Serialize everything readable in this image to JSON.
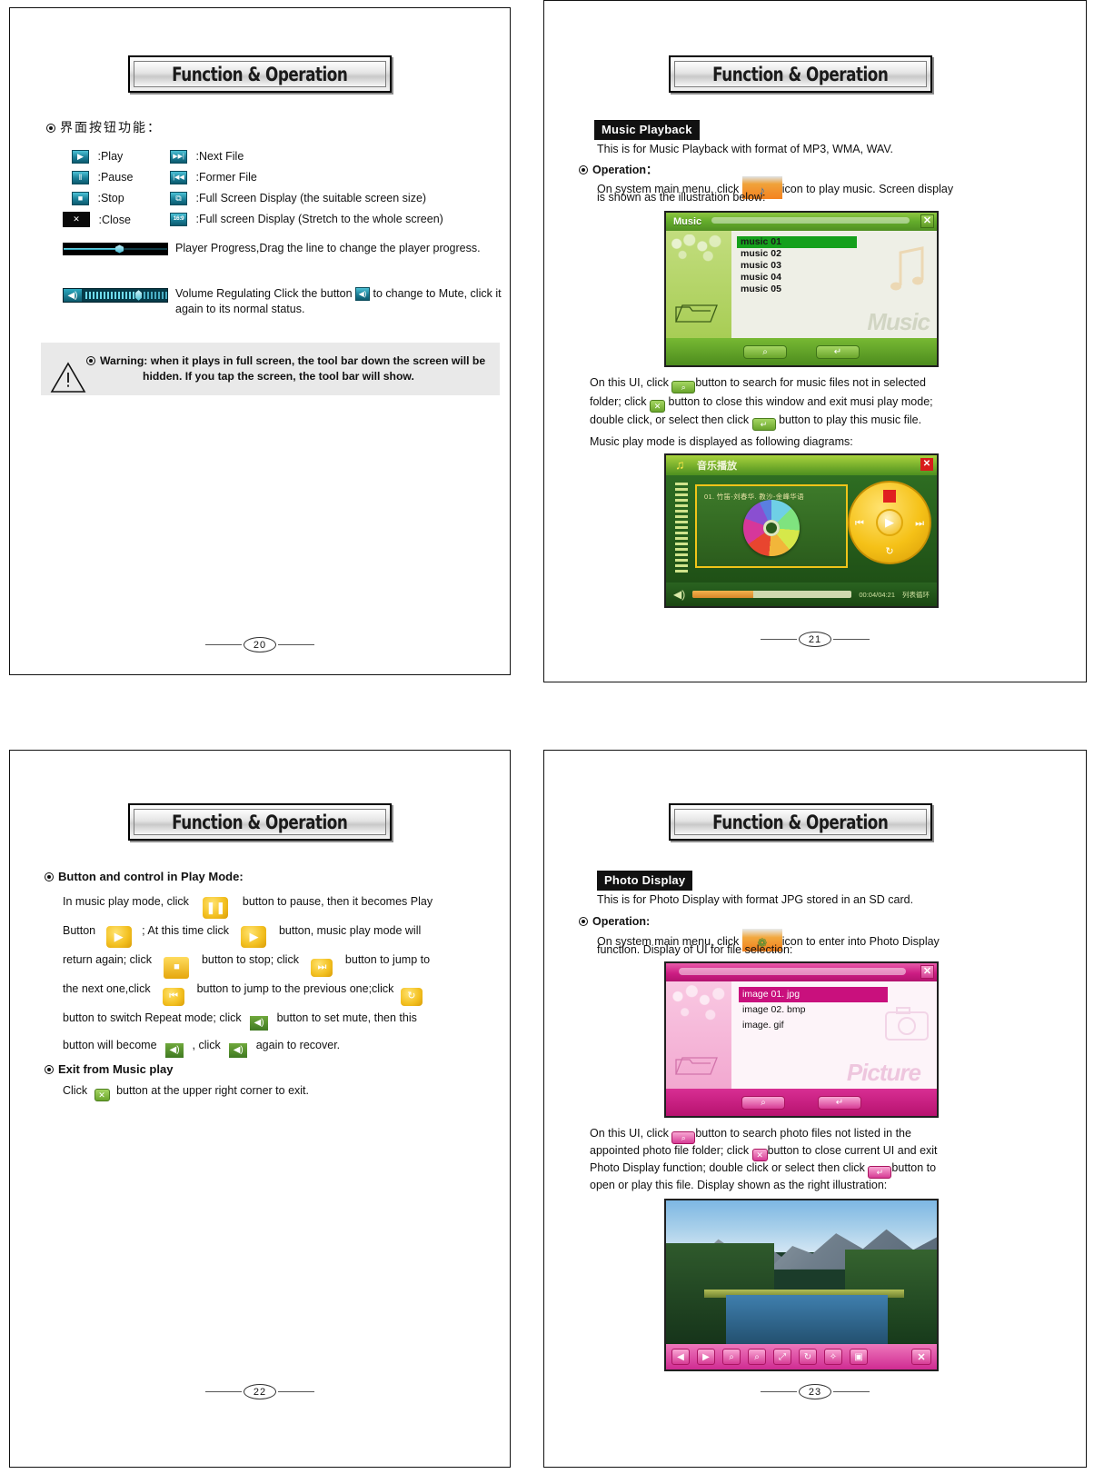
{
  "pages": [
    {
      "id": "page-20",
      "banner": "Function & Operation",
      "page_number": "20",
      "heading_cn": "界面按钮功能：",
      "icon_legend_left": [
        {
          "icon": "play-icon",
          "glyph": "▶",
          "label": ":Play"
        },
        {
          "icon": "pause-icon",
          "glyph": "‖",
          "label": ":Pause"
        },
        {
          "icon": "stop-icon",
          "glyph": "■",
          "label": ":Stop"
        },
        {
          "icon": "close-icon",
          "glyph": "✕",
          "label": ":Close"
        }
      ],
      "icon_legend_right": [
        {
          "icon": "next-file-icon",
          "glyph": "▶▶|",
          "label": ":Next File"
        },
        {
          "icon": "former-file-icon",
          "glyph": "|◀◀",
          "label": ":Former File"
        },
        {
          "icon": "full-screen-fit-icon",
          "glyph": "⧉",
          "label": ":Full Screen Display (the suitable screen size)"
        },
        {
          "icon": "full-screen-stretch-icon",
          "glyph": "16:9",
          "label": ":Full screen Display (Stretch to the whole screen)"
        }
      ],
      "progress_note": "Player Progress,Drag the line to change the player progress.",
      "volume_note_a": "Volume Regulating Click the button",
      "volume_note_b": "to change to Mute, click it again to its normal status.",
      "warning_label": "Warning:",
      "warning_text": "when it plays in full screen, the tool bar down the screen will be hidden. If you tap the screen, the tool bar will show."
    },
    {
      "id": "page-21",
      "banner": "Function & Operation",
      "page_number": "21",
      "section_tag": "Music Playback",
      "intro": "This is for Music Playback with format of MP3, WMA, WAV.",
      "operation_label": "Operation：",
      "operation_line_a": "On system main menu, click",
      "operation_line_b": "icon to play music. Screen display",
      "operation_line_c": " is shown as the illustration below:",
      "music_window": {
        "title": "Music",
        "files": [
          "music 01",
          "music 02",
          "music 03",
          "music 04",
          "music 05"
        ],
        "selected_index": 0,
        "watermark": "Music",
        "close_glyph": "✕",
        "search_glyph": "⌕",
        "enter_glyph": "↵"
      },
      "desc_1a": "On this UI, click",
      "desc_1b": "button to search for music files not in selected",
      "desc_2a": "folder; click",
      "desc_2b": "button to close this window and exit musi play mode;",
      "desc_3a": "double click, or select then click",
      "desc_3b": "button to play this music file.",
      "desc_4": "Music play mode is displayed as following diagrams:",
      "player_window": {
        "title_cn": "音乐播放",
        "track": "01. 竹笛-刘春华. 教沙-金峰华语",
        "time": "00:04/04:21",
        "repeat_mode": "列表循环",
        "close_glyph": "✕"
      }
    },
    {
      "id": "page-22",
      "banner": "Function & Operation",
      "page_number": "22",
      "section_title": "Button and control in Play Mode:",
      "lines": [
        {
          "pre": "In music play mode, click",
          "icon": "pause-button-icon",
          "post": "button to pause, then it becomes Play"
        },
        {
          "pre": "Button",
          "icon": "play-button-icon",
          "post": "; At this time click",
          "icon2": "play-button-icon",
          "post2": "button, music play mode will"
        },
        {
          "pre": "return again; click",
          "icon": "stop-button-icon",
          "post": "button to stop; click",
          "icon2": "next-track-icon",
          "post2": "button to jump to"
        },
        {
          "pre": "the next one,click",
          "icon": "prev-track-icon",
          "post": "button to jump to the previous one;click",
          "icon2": "repeat-mode-icon",
          "post2": ""
        },
        {
          "pre": "button to switch Repeat mode; click",
          "icon": "mute-icon",
          "post": "button to set mute, then this"
        },
        {
          "pre": "button will become",
          "icon": "muted-icon",
          "post": ", click",
          "icon2": "muted-icon",
          "post2": "again to recover."
        }
      ],
      "exit_title": "Exit from Music play",
      "exit_line_a": "Click",
      "exit_line_b": "button at the upper right corner to exit."
    },
    {
      "id": "page-23",
      "banner": "Function & Operation",
      "page_number": "23",
      "section_tag": "Photo Display",
      "intro": "This is for Photo Display with format JPG stored in an SD card.",
      "operation_label": "Operation:",
      "operation_line_a": "On system main menu, click",
      "operation_line_b": "icon to enter into Photo Display",
      "operation_line_c": "function. Display of UI for file selection:",
      "picture_window": {
        "files": [
          "image 01. jpg",
          "image 02. bmp",
          "image. gif"
        ],
        "selected_index": 0,
        "watermark": "Picture",
        "close_glyph": "✕",
        "search_glyph": "⌕",
        "enter_glyph": "↵"
      },
      "desc_1a": "On this UI, click",
      "desc_1b": "button to search photo files not listed in the",
      "desc_2a": "appointed photo file folder; click",
      "desc_2b": "button to close current UI and exit",
      "desc_3a": "Photo Display function; double click or select then click",
      "desc_3b": "button to",
      "desc_4": "open or play this file. Display shown as the right illustration:",
      "photo_toolbar": [
        {
          "name": "prev-photo-button",
          "glyph": "◀"
        },
        {
          "name": "next-photo-button",
          "glyph": "▶"
        },
        {
          "name": "zoom-out-button",
          "glyph": "⌕"
        },
        {
          "name": "zoom-in-button",
          "glyph": "⌕"
        },
        {
          "name": "fit-button",
          "glyph": "⤢"
        },
        {
          "name": "rotate-button",
          "glyph": "↻"
        },
        {
          "name": "effects-button",
          "glyph": "✧"
        },
        {
          "name": "slideshow-button",
          "glyph": "▣"
        }
      ],
      "photo_close_glyph": "✕"
    }
  ]
}
